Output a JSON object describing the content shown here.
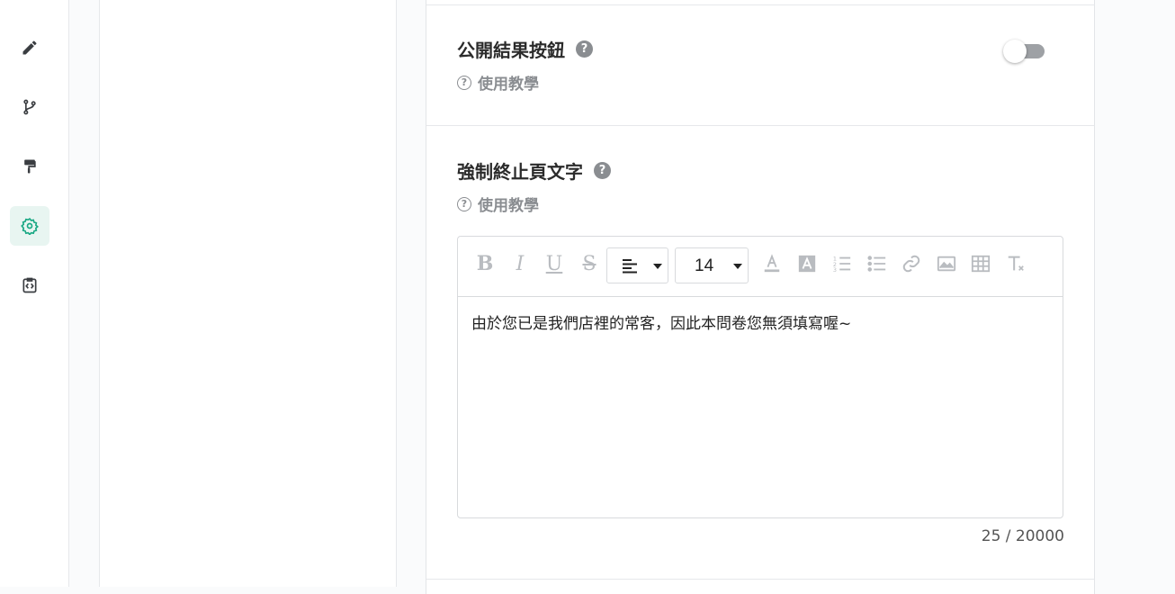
{
  "sidebar": {
    "icons": [
      {
        "name": "pencil-icon",
        "active": false
      },
      {
        "name": "branch-icon",
        "active": false
      },
      {
        "name": "paint-roller-icon",
        "active": false
      },
      {
        "name": "gear-icon",
        "active": true
      },
      {
        "name": "code-clipboard-icon",
        "active": false
      }
    ],
    "accent_color": "#1aa884"
  },
  "settings": {
    "public_results": {
      "title": "公開結果按鈕",
      "help": "?",
      "tutorial": "使用教學",
      "enabled": false
    },
    "force_end_text": {
      "title": "強制終止頁文字",
      "help": "?",
      "tutorial": "使用教學"
    }
  },
  "editor": {
    "toolbar": {
      "bold": "B",
      "italic": "I",
      "underline": "U",
      "strike": "S",
      "align_icon": "align-left-icon",
      "font_size": "14",
      "text_color_icon": "text-color-icon",
      "bg_color_icon": "background-color-icon",
      "ordered_list_icon": "ordered-list-icon",
      "bullet_list_icon": "bullet-list-icon",
      "link_icon": "link-icon",
      "image_icon": "image-icon",
      "table_icon": "table-icon",
      "clear_format_icon": "clear-format-icon"
    },
    "content": "由於您已是我們店裡的常客，因此本問卷您無須填寫喔~",
    "counter": "25 / 20000"
  }
}
